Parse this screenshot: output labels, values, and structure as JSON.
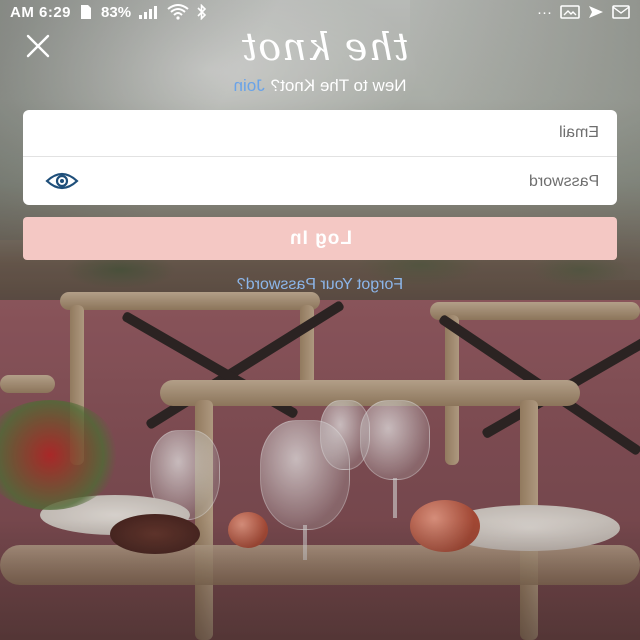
{
  "status_bar": {
    "time": "AM 6:29",
    "battery": "83%",
    "overflow": "···"
  },
  "header": {
    "logo_text": "the knot",
    "close_icon": "close-icon"
  },
  "join_row": {
    "prompt": "New to The Knot?",
    "join_label": "Join"
  },
  "form": {
    "email_placeholder": "Email",
    "password_placeholder": "Password",
    "show_password_icon": "eye-icon"
  },
  "login_button": {
    "label": "Log In",
    "color": "#f4c8c4"
  },
  "forgot_password": {
    "label": "Forgot Your Password?"
  },
  "colors": {
    "accent_link": "#6aa3e8",
    "button_bg": "#f4c8c4"
  }
}
